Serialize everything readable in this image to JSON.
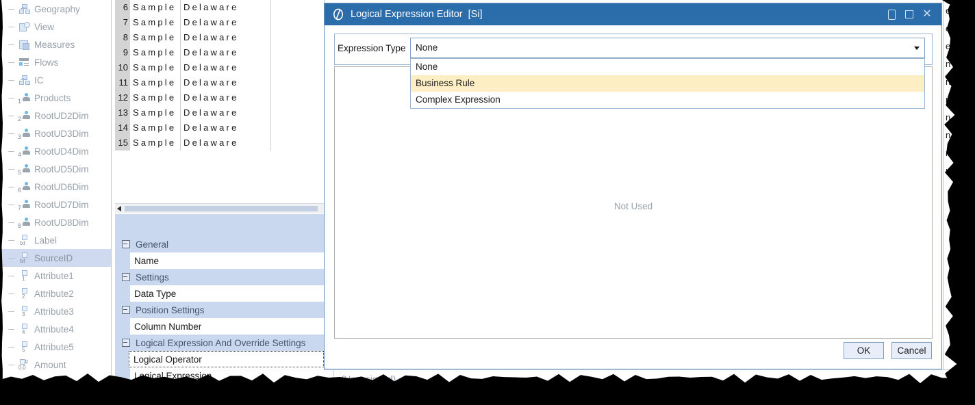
{
  "tree": {
    "items": [
      {
        "label": "Geography",
        "icon": "org-chart-icon",
        "selected": false
      },
      {
        "label": "View",
        "icon": "view-icon",
        "selected": false
      },
      {
        "label": "Measures",
        "icon": "measures-icon",
        "selected": false
      },
      {
        "label": "Flows",
        "icon": "flows-icon",
        "selected": false
      },
      {
        "label": "IC",
        "icon": "ic-icon",
        "selected": false
      },
      {
        "label": "Products",
        "icon": "dimension-1-icon",
        "selected": false,
        "num": "1"
      },
      {
        "label": "RootUD2Dim",
        "icon": "dimension-2-icon",
        "selected": false,
        "num": "2"
      },
      {
        "label": "RootUD3Dim",
        "icon": "dimension-3-icon",
        "selected": false,
        "num": "3"
      },
      {
        "label": "RootUD4Dim",
        "icon": "dimension-4-icon",
        "selected": false,
        "num": "4"
      },
      {
        "label": "RootUD5Dim",
        "icon": "dimension-5-icon",
        "selected": false,
        "num": "5"
      },
      {
        "label": "RootUD6Dim",
        "icon": "dimension-6-icon",
        "selected": false,
        "num": "6"
      },
      {
        "label": "RootUD7Dim",
        "icon": "dimension-7-icon",
        "selected": false,
        "num": "7"
      },
      {
        "label": "RootUD8Dim",
        "icon": "dimension-8-icon",
        "selected": false,
        "num": "8"
      },
      {
        "label": "Label",
        "icon": "text-field-icon",
        "selected": false,
        "num": "txt"
      },
      {
        "label": "SourceID",
        "icon": "text-field-icon",
        "selected": true,
        "num": "txt"
      },
      {
        "label": "Attribute1",
        "icon": "attribute-1-icon",
        "selected": false,
        "num": "1"
      },
      {
        "label": "Attribute2",
        "icon": "attribute-2-icon",
        "selected": false,
        "num": "2"
      },
      {
        "label": "Attribute3",
        "icon": "attribute-3-icon",
        "selected": false,
        "num": "3"
      },
      {
        "label": "Attribute4",
        "icon": "attribute-4-icon",
        "selected": false,
        "num": "4"
      },
      {
        "label": "Attribute5",
        "icon": "attribute-5-icon",
        "selected": false,
        "num": "5"
      },
      {
        "label": "Amount",
        "icon": "amount-icon",
        "selected": false,
        "num": "0.0"
      }
    ]
  },
  "grid": {
    "rows": [
      {
        "num": "6",
        "col1": "Sample",
        "col2": "Delaware"
      },
      {
        "num": "7",
        "col1": "Sample",
        "col2": "Delaware"
      },
      {
        "num": "8",
        "col1": "Sample",
        "col2": "Delaware"
      },
      {
        "num": "9",
        "col1": "Sample",
        "col2": "Delaware"
      },
      {
        "num": "10",
        "col1": "Sample",
        "col2": "Delaware"
      },
      {
        "num": "11",
        "col1": "Sample",
        "col2": "Delaware"
      },
      {
        "num": "12",
        "col1": "Sample",
        "col2": "Delaware"
      },
      {
        "num": "13",
        "col1": "Sample",
        "col2": "Delaware"
      },
      {
        "num": "14",
        "col1": "Sample",
        "col2": "Delaware"
      },
      {
        "num": "15",
        "col1": "Sample",
        "col2": "Delaware"
      }
    ]
  },
  "properties": {
    "groups": [
      {
        "title": "General",
        "rows": [
          {
            "label": "Name",
            "focused": false
          }
        ]
      },
      {
        "title": "Settings",
        "rows": [
          {
            "label": "Data Type",
            "focused": false
          }
        ]
      },
      {
        "title": "Position Settings",
        "rows": [
          {
            "label": "Column Number",
            "focused": false
          }
        ]
      },
      {
        "title": "Logical Expression And Override Settings",
        "rows": [
          {
            "label": "Logical Operator",
            "focused": true
          },
          {
            "label": "Logical Expression",
            "focused": false
          }
        ]
      }
    ]
  },
  "statusbar": {
    "text": "(Unassigned)"
  },
  "background": {
    "fragments": [
      "e",
      "e",
      "e",
      "n",
      "n",
      "n",
      "n",
      "n",
      "n",
      "n e"
    ]
  },
  "dialog": {
    "title": "Logical Expression Editor",
    "tag": "[Si]",
    "logo_icon": "app-logo-icon",
    "window_buttons": [
      {
        "name": "minimize-button",
        "icon": "minimize-icon"
      },
      {
        "name": "restore-button",
        "icon": "restore-icon"
      },
      {
        "name": "close-button",
        "icon": "close-icon",
        "glyph": "✕"
      }
    ],
    "expression_type": {
      "label": "Expression Type",
      "value": "None",
      "options": [
        {
          "label": "None",
          "highlighted": false
        },
        {
          "label": "Business Rule",
          "highlighted": true
        },
        {
          "label": "Complex Expression",
          "highlighted": false
        }
      ]
    },
    "editor_placeholder": "Not Used",
    "buttons": [
      {
        "label": "OK",
        "name": "ok-button"
      },
      {
        "label": "Cancel",
        "name": "cancel-button"
      }
    ]
  },
  "colors": {
    "title_bar": "#2b6cab",
    "highlight_option": "#fdeec4",
    "tree_selection": "#cfd9ef",
    "props_group_bg": "#c9d7ef"
  }
}
